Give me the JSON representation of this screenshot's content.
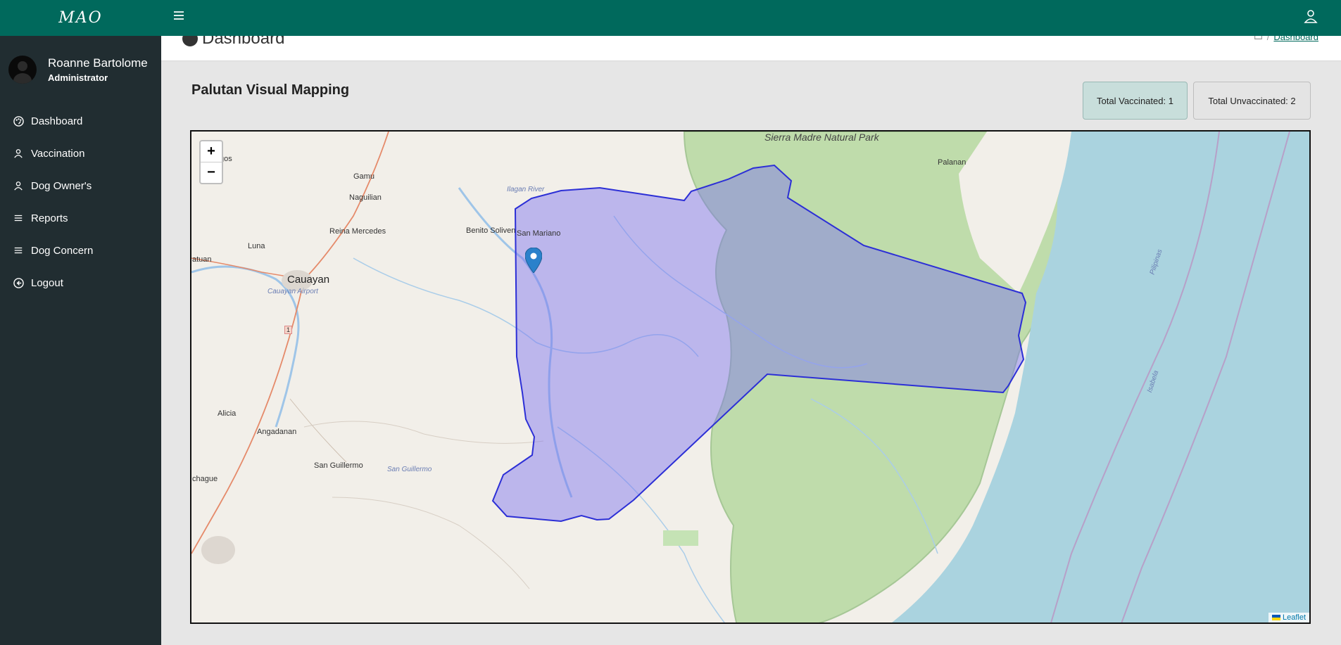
{
  "app": {
    "brand": "MAO"
  },
  "user": {
    "name": "Roanne Bartolome",
    "role": "Administrator"
  },
  "nav": [
    {
      "label": "Dashboard",
      "icon": "palette-icon"
    },
    {
      "label": "Vaccination",
      "icon": "user-icon"
    },
    {
      "label": "Dog Owner's",
      "icon": "user-icon"
    },
    {
      "label": "Reports",
      "icon": "list-icon"
    },
    {
      "label": "Dog Concern",
      "icon": "list-icon"
    },
    {
      "label": "Logout",
      "icon": "back-circle-icon"
    }
  ],
  "header": {
    "title": "Dashboard",
    "breadcrumb": "Dashboard"
  },
  "main": {
    "section_title": "Palutan Visual Mapping",
    "stats": {
      "vaccinated": "Total Vaccinated: 1",
      "unvaccinated": "Total Unvaccinated: 2"
    }
  },
  "map": {
    "zoom_in": "+",
    "zoom_out": "−",
    "attribution": "Leaflet",
    "labels": {
      "gamu": "Gamu",
      "naguilian": "Naguilian",
      "reina": "Reina Mercedes",
      "luna": "Luna",
      "cauayan": "Cauayan",
      "airport": "Cauayan Airport",
      "alicia": "Alicia",
      "angadanan": "Angadanan",
      "sanguillermo": "San Guillermo",
      "sanguillermo_water": "San Guillermo",
      "echague": "chague",
      "benito": "Benito Soliven",
      "sanmariano": "San Mariano",
      "ilagan": "Ilagan River",
      "sierra": "Sierra Madre Natural Park",
      "palanan": "Palanan",
      "atuan": "atuan",
      "gos": "gos",
      "isabela": "Isabela",
      "pilipinas": "Pilipinas",
      "route": "1"
    },
    "colors": {
      "polygon_fill": "#7b72f0",
      "polygon_stroke": "#2c2fd6",
      "sea": "#aad3df",
      "park": "#bfdcab",
      "land": "#f2efe9"
    }
  }
}
